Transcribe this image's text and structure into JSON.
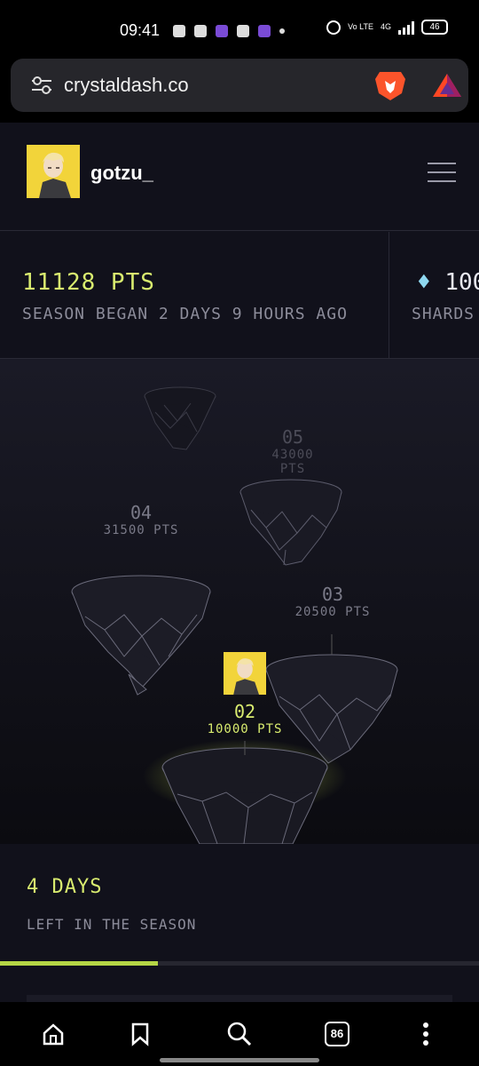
{
  "status_bar": {
    "time": "09:41",
    "network": "Vo LTE",
    "network_type": "4G",
    "battery": "46"
  },
  "browser": {
    "url": "crystaldash.co"
  },
  "header": {
    "username": "gotzu_"
  },
  "stats": {
    "points": "11128 PTS",
    "season_began": "SEASON BEGAN 2 DAYS 9 HOURS AGO",
    "shards_value": "100",
    "shards_label": "SHARDS"
  },
  "levels": [
    {
      "num": "05",
      "pts": "43000 PTS"
    },
    {
      "num": "04",
      "pts": "31500 PTS"
    },
    {
      "num": "03",
      "pts": "20500 PTS"
    },
    {
      "num": "02",
      "pts": "10000 PTS"
    }
  ],
  "season": {
    "days_left": "4 DAYS",
    "left_label": "LEFT IN THE SEASON",
    "progress_fraction": 0.33
  },
  "nav": {
    "tabs_count": "86"
  },
  "colors": {
    "accent": "#d9ec6f",
    "background": "#11111b",
    "avatar_yellow": "#f2d43a"
  }
}
